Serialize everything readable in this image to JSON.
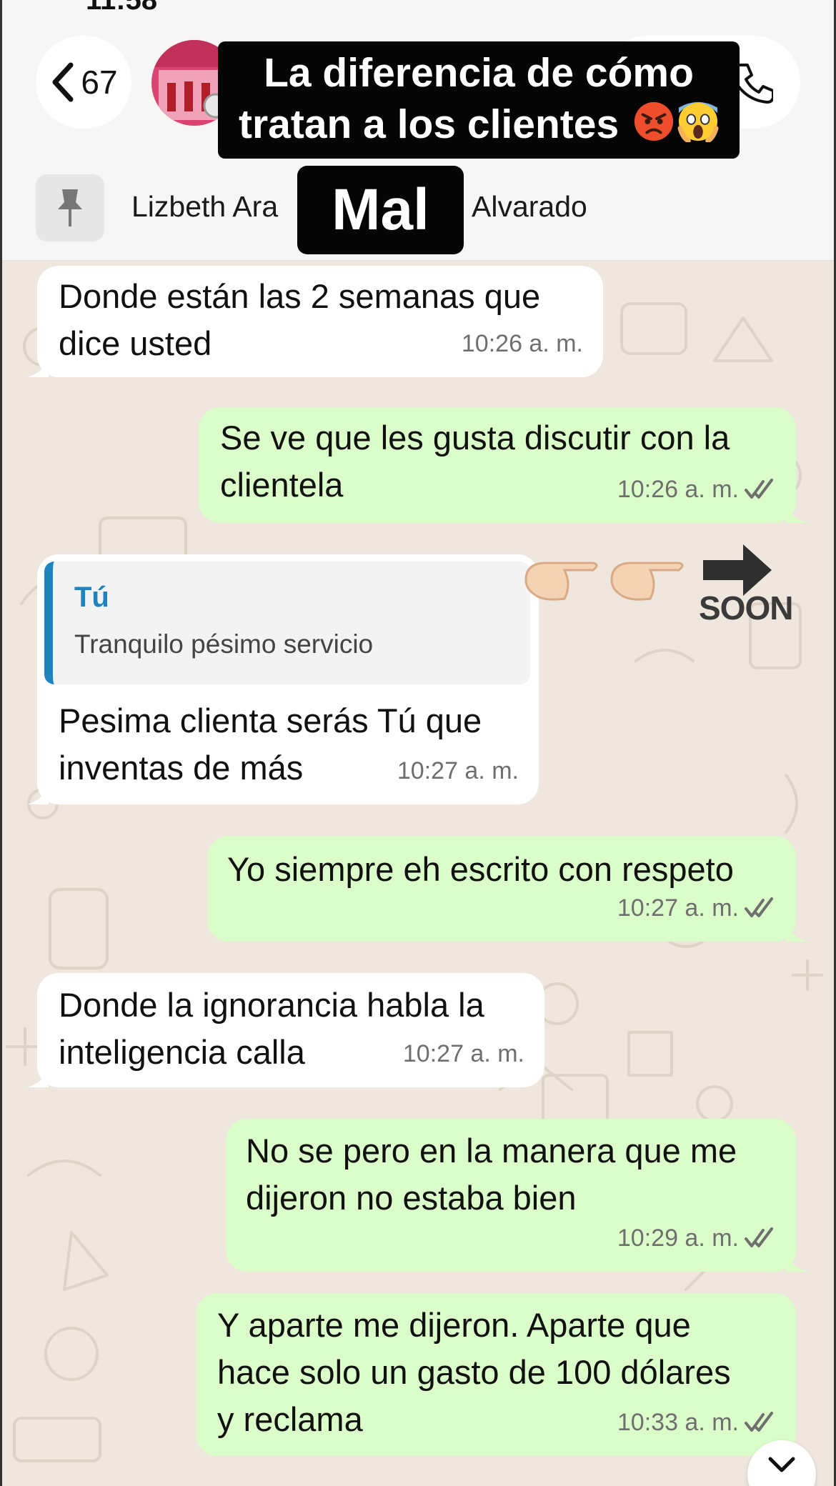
{
  "status_bar": {
    "time": "11:58"
  },
  "header": {
    "back_count": "67",
    "pinned_name_start": "Lizbeth Ara",
    "pinned_name_end": "Alvarado"
  },
  "overlays": {
    "title_line1": "La diferencia de cómo",
    "title_line2": "tratan a los clientes",
    "label": "Mal",
    "soon": "SOON"
  },
  "messages": [
    {
      "direction": "incoming",
      "lines": [
        "Donde están las 2 semanas que",
        "dice usted"
      ],
      "time": "10:26 a. m."
    },
    {
      "direction": "outgoing",
      "lines": [
        "Se ve que les gusta discutir con la",
        "clientela"
      ],
      "time": "10:26 a. m.",
      "status": "read"
    },
    {
      "direction": "incoming",
      "quote": {
        "author": "Tú",
        "text": "Tranquilo pésimo servicio"
      },
      "lines": [
        "Pesima clienta serás Tú que",
        "inventas de más"
      ],
      "time": "10:27 a. m."
    },
    {
      "direction": "outgoing",
      "lines": [
        "Yo siempre eh escrito con respeto"
      ],
      "time": "10:27 a. m.",
      "status": "read"
    },
    {
      "direction": "incoming",
      "lines": [
        "Donde la ignorancia habla la",
        "inteligencia calla"
      ],
      "time": "10:27 a. m."
    },
    {
      "direction": "outgoing",
      "lines": [
        "No se pero en la manera que me",
        "dijeron no estaba bien"
      ],
      "time": "10:29 a. m.",
      "status": "read"
    },
    {
      "direction": "outgoing",
      "lines": [
        "Y aparte me dijeron. Aparte que",
        "hace solo un gasto de 100 dólares",
        "y reclama"
      ],
      "time": "10:33 a. m.",
      "status": "read"
    }
  ],
  "colors": {
    "outgoing_bubble": "#dafdc9",
    "incoming_bubble": "#ffffff",
    "chat_background": "#efe7dd",
    "quote_accent": "#1f83bd",
    "read_ticks": "#6f6f6f"
  },
  "icons": [
    "chevron-left-icon",
    "phone-icon",
    "pin-icon",
    "double-check-icon",
    "chevron-down-icon",
    "angry-face-emoji",
    "screaming-face-emoji",
    "pointing-hand-emoji",
    "arrow-right-icon"
  ]
}
